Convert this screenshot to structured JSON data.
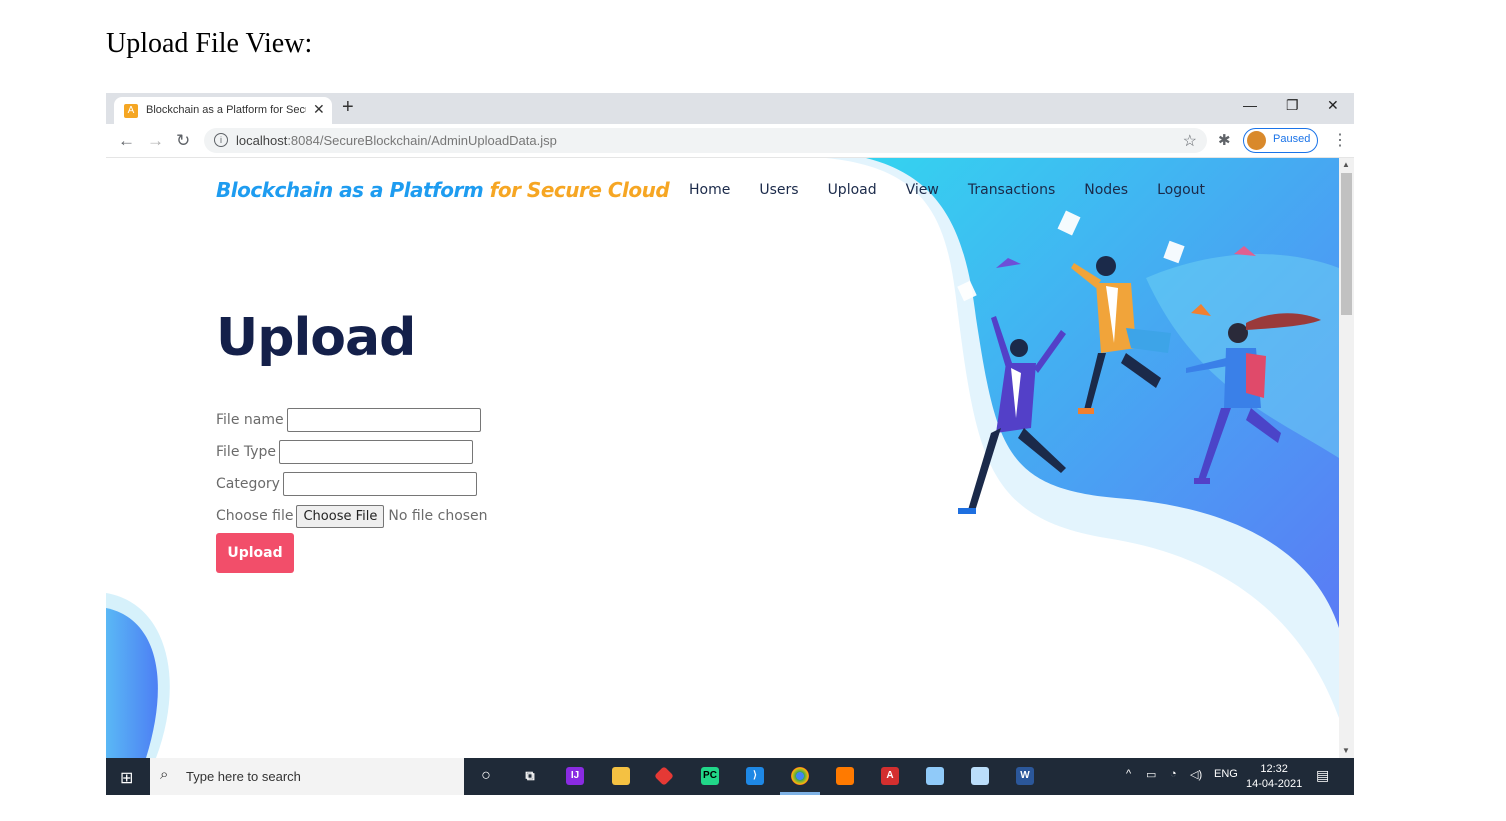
{
  "doc_title": "Upload File View:",
  "browser": {
    "tab_title": "Blockchain as a Platform for Secure Cloud",
    "tab_favicon": "A",
    "url_host": "localhost",
    "url_rest": ":8084/SecureBlockchain/AdminUploadData.jsp",
    "profile_label": "Paused"
  },
  "site": {
    "brand_part1": "Blockchain as a Platform ",
    "brand_part2": "for Secure Cloud",
    "nav": [
      "Home",
      "Users",
      "Upload",
      "View",
      "Transactions",
      "Nodes",
      "Logout"
    ],
    "heading": "Upload",
    "form": {
      "file_name_label": "File name",
      "file_type_label": "File Type",
      "category_label": "Category",
      "choose_file_label": "Choose file",
      "choose_file_button": "Choose File",
      "no_file_text": "No file chosen",
      "submit_label": "Upload"
    }
  },
  "taskbar": {
    "search_placeholder": "Type here to search",
    "lang": "ENG",
    "time": "12:32",
    "date": "14-04-2021"
  },
  "colors": {
    "brand_blue": "#1e9cf0",
    "brand_orange": "#f6a623",
    "heading_navy": "#14204a",
    "button_red": "#f24e6a"
  }
}
